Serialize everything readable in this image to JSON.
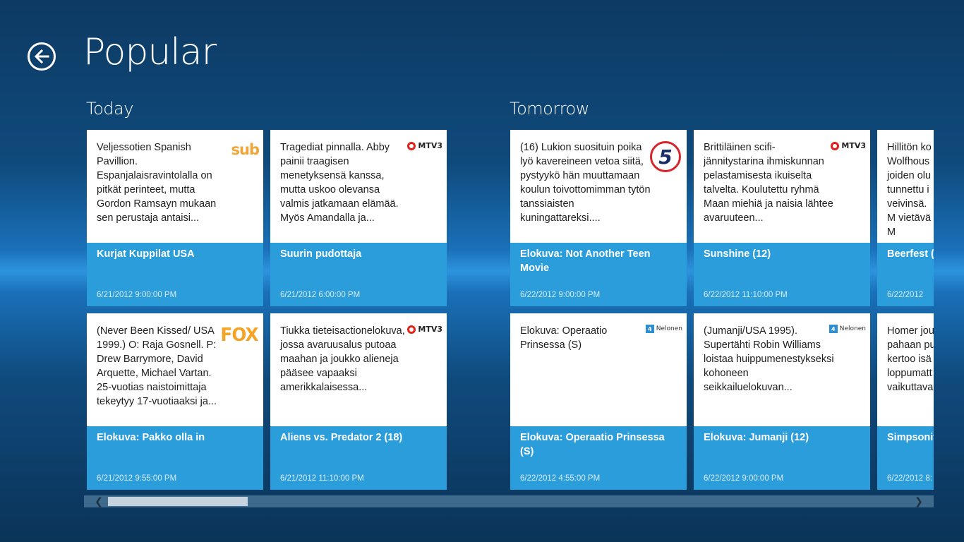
{
  "header": {
    "title": "Popular",
    "back_icon": "back-arrow-icon"
  },
  "groups": [
    {
      "title": "Today"
    },
    {
      "title": "Tomorrow"
    }
  ],
  "tiles": [
    {
      "description": "Veljessotien Spanish Pavillion. Espanjalaisravintolalla on pitkät perinteet, mutta Gordon Ramsayn mukaan sen perustaja antaisi...",
      "channel_logo": "sub",
      "program": "Kurjat Kuppilat USA",
      "time": "6/21/2012 9:00:00 PM"
    },
    {
      "description": "Tragediat pinnalla. Abby painii traagisen menetyksensä kanssa, mutta uskoo olevansa valmis jatkamaan elämää. Myös Amandalla ja...",
      "channel_logo": "MTV3",
      "program": "Suurin pudottaja",
      "time": "6/21/2012 6:00:00 PM"
    },
    {
      "description": "(Never Been Kissed/ USA 1999.) O: Raja Gosnell. P: Drew Barrymore, David Arquette, Michael Vartan. 25-vuotias naistoimittaja tekeytyy 17-vuotiaaksi ja...",
      "channel_logo": "FOX",
      "program": "Elokuva: Pakko olla in",
      "time": "6/21/2012 9:55:00 PM"
    },
    {
      "description": "Tiukka tieteisactionelokuva, jossa avaruusalus putoaa maahan ja joukko alieneja pääsee vapaaksi amerikkalaisessa...",
      "channel_logo": "MTV3",
      "program": "Aliens vs. Predator 2 (18)",
      "time": "6/21/2012 11:10:00 PM"
    },
    {
      "description": "(16) Lukion suosituin poika lyö kavereineen vetoa siitä, pystyykö hän muuttamaan koulun toivottomimman tytön tanssiaisten kuningattareksi....",
      "channel_logo": "5",
      "program": "Elokuva: Not Another Teen Movie",
      "time": "6/22/2012 9:00:00 PM"
    },
    {
      "description": "Elokuva: Operaatio Prinsessa (S)",
      "channel_logo": "Nelonen",
      "program": "Elokuva: Operaatio Prinsessa (S)",
      "time": "6/22/2012 4:55:00 PM"
    },
    {
      "description": "Brittiläinen scifi-jännitystarina ihmiskunnan pelastamisesta ikuiselta talvelta. Koulutettu ryhmä Maan miehiä ja naisia lähtee avaruuteen...",
      "channel_logo": "MTV3",
      "program": "Sunshine (12)",
      "time": "6/22/2012 11:10:00 PM"
    },
    {
      "description": "(Jumanji/USA 1995). Supertähti Robin Williams loistaa huippumenestykseksi kohoneen seikkailuelokuvan...",
      "channel_logo": "Nelonen",
      "program": "Elokuva: Jumanji (12)",
      "time": "6/22/2012 9:00:00 PM"
    },
    {
      "description": "Hillitön ko Wolfhous joiden olu tunnettu i veivinsä. M vietävä M",
      "channel_logo": "",
      "program": "Beerfest (",
      "time": "6/22/2012"
    },
    {
      "description": "Homer jou pahaan pu kertoo isä loppumatt vaikuttava",
      "channel_logo": "",
      "program": "Simpsonit",
      "time": "6/22/2012 8:"
    }
  ],
  "scrollbar": {
    "left_icon": "scroll-left-icon",
    "right_icon": "scroll-right-icon",
    "position_fraction": 0.0
  },
  "colors": {
    "tile_accent": "#2b9ddb",
    "background": "#0f4a7c"
  }
}
